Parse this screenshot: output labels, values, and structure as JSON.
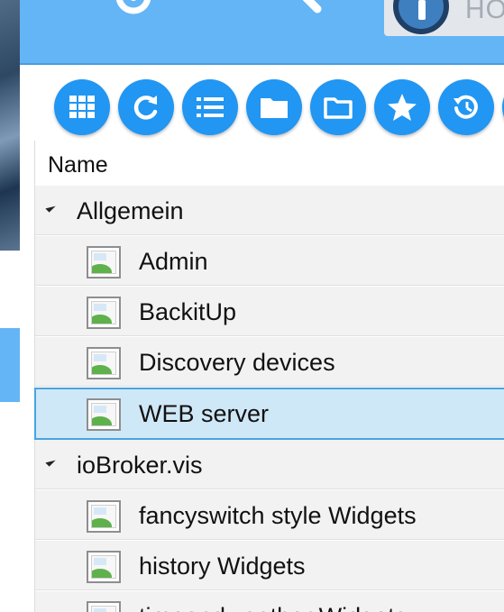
{
  "header": {
    "home_label": "HO",
    "icons": [
      "settings-icon",
      "search-icon",
      "iobroker-logo"
    ]
  },
  "toolbar": {
    "buttons": [
      {
        "icon": "grid-view-icon"
      },
      {
        "icon": "refresh-icon"
      },
      {
        "icon": "list-view-icon"
      },
      {
        "icon": "folder-filled-icon"
      },
      {
        "icon": "folder-outline-icon"
      },
      {
        "icon": "star-icon"
      },
      {
        "icon": "history-icon"
      }
    ]
  },
  "tree": {
    "column_header": "Name",
    "groups": [
      {
        "label": "Allgemein",
        "items": [
          {
            "label": "Admin"
          },
          {
            "label": "BackitUp"
          },
          {
            "label": "Discovery devices"
          },
          {
            "label": "WEB server",
            "selected": true
          }
        ]
      },
      {
        "label": "ioBroker.vis",
        "items": [
          {
            "label": "fancyswitch style Widgets"
          },
          {
            "label": "history Widgets"
          },
          {
            "label": "timeandweather Widgets"
          }
        ]
      }
    ]
  },
  "colors": {
    "header_bg": "#64b5f6",
    "button_bg": "#2196f3",
    "row_bg": "#f2f2f2",
    "selected_bg": "#cfe8f7",
    "selected_border": "#4aa3df"
  }
}
